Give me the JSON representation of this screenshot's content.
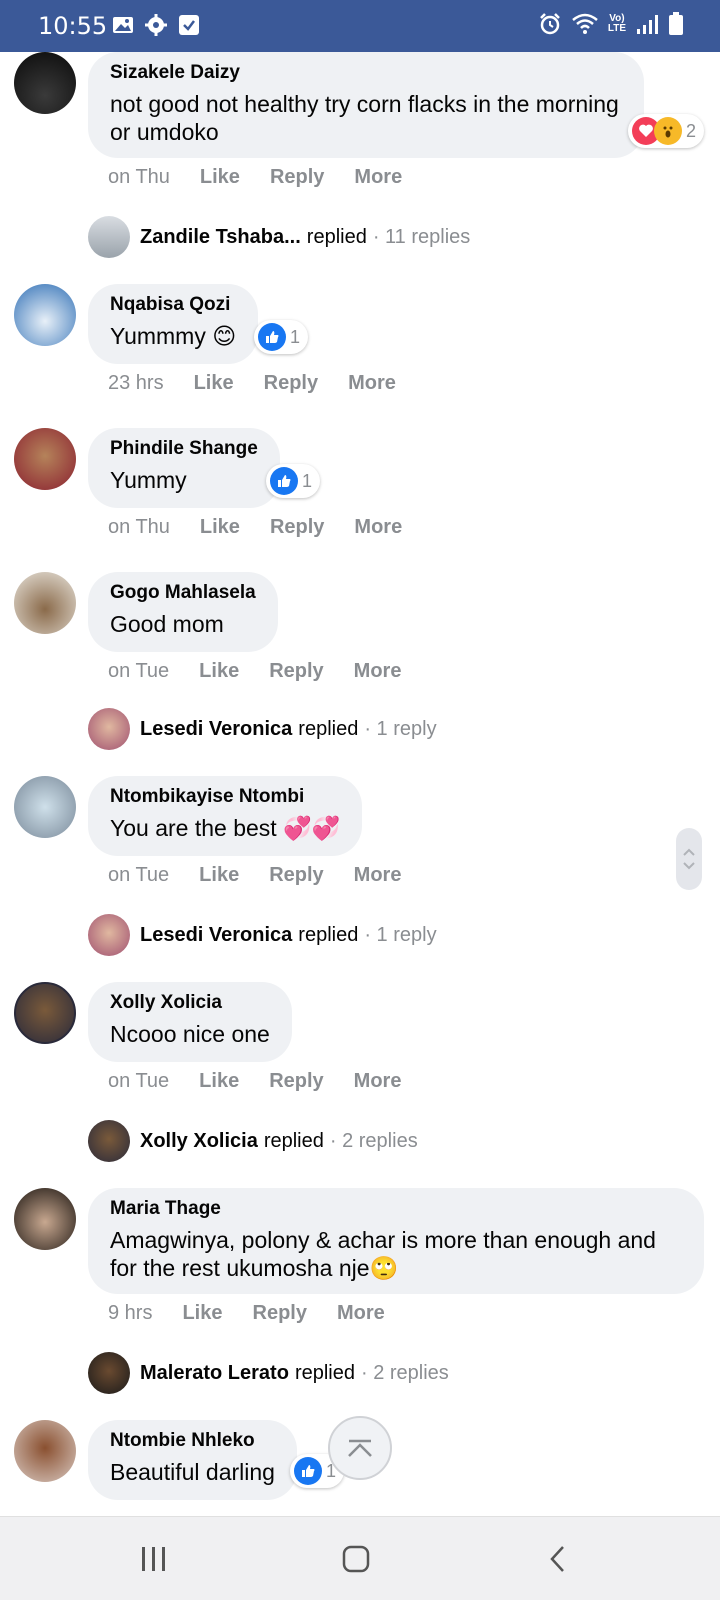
{
  "status_bar": {
    "time": "10:55",
    "net_top": "Vo)",
    "net_bottom": "LTE"
  },
  "colors": {
    "header_bg": "#3b5998",
    "bubble_bg": "#eff1f4",
    "meta_text": "#8a8d91",
    "like_blue": "#1877f2"
  },
  "comments": [
    {
      "author": "Sizakele Daizy",
      "text": "not good not healthy try corn flacks in the morning or umdoko",
      "time": "on Thu",
      "like": "Like",
      "reply": "Reply",
      "more": "More",
      "reactions": [
        "love",
        "wow"
      ],
      "reaction_count": "2"
    },
    {
      "reply_author": "Zandile Tshaba...",
      "replied": "replied",
      "reply_count": "· 11 replies"
    },
    {
      "author": "Nqabisa Qozi",
      "text": "Yummmy 😊",
      "time": "23 hrs",
      "like": "Like",
      "reply": "Reply",
      "more": "More",
      "reactions": [
        "like"
      ],
      "reaction_count": "1"
    },
    {
      "author": "Phindile Shange",
      "text": "Yummy",
      "time": "on Thu",
      "like": "Like",
      "reply": "Reply",
      "more": "More",
      "reactions": [
        "like"
      ],
      "reaction_count": "1"
    },
    {
      "author": "Gogo Mahlasela",
      "text": "Good mom",
      "time": "on Tue",
      "like": "Like",
      "reply": "Reply",
      "more": "More"
    },
    {
      "reply_author": "Lesedi Veronica",
      "replied": "replied",
      "reply_count": "· 1 reply"
    },
    {
      "author": "Ntombikayise Ntombi",
      "text": "You are the best 💞💞",
      "time": "on Tue",
      "like": "Like",
      "reply": "Reply",
      "more": "More"
    },
    {
      "reply_author": "Lesedi Veronica",
      "replied": "replied",
      "reply_count": "· 1 reply"
    },
    {
      "author": "Xolly Xolicia",
      "text": "Ncooo nice one",
      "time": "on Tue",
      "like": "Like",
      "reply": "Reply",
      "more": "More"
    },
    {
      "reply_author": "Xolly Xolicia",
      "replied": "replied",
      "reply_count": "· 2 replies"
    },
    {
      "author": "Maria Thage",
      "text": "Amagwinya, polony & achar is more than enough and for the rest ukumosha nje🙄",
      "time": "9 hrs",
      "like": "Like",
      "reply": "Reply",
      "more": "More"
    },
    {
      "reply_author": "Malerato Lerato",
      "replied": "replied",
      "reply_count": "· 2 replies"
    },
    {
      "author": "Ntombie Nhleko",
      "text": "Beautiful darling",
      "reactions": [
        "like"
      ],
      "reaction_count": "1"
    }
  ]
}
